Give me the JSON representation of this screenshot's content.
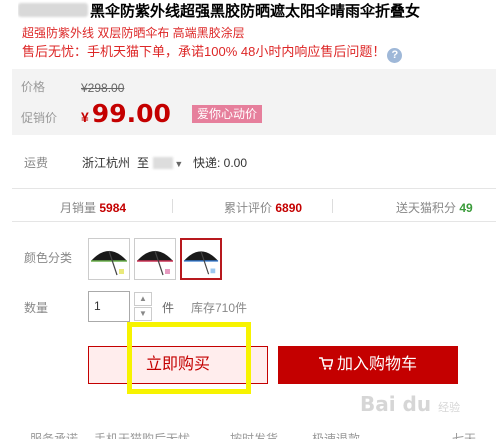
{
  "product": {
    "title": "黑伞防紫外线超强黑胶防晒遮太阳伞晴雨伞折叠女",
    "subtitle": "超强防紫外线 双层防晒伞布 高端黑胶涂层",
    "service_note": "售后无忧：手机天猫下单，承诺100% 48小时内响应售后问题！"
  },
  "price": {
    "orig_label": "价格",
    "orig_value": "¥298.00",
    "promo_label": "促销价",
    "currency": "¥",
    "promo_value": "99.00",
    "promo_tag": "爱你心动价"
  },
  "shipping": {
    "label": "运费",
    "from": "浙江杭州",
    "to_label": "至",
    "fee": "快递: 0.00"
  },
  "stats": {
    "monthly_label": "月销量",
    "monthly_value": "5984",
    "reviews_label": "累计评价",
    "reviews_value": "6890",
    "points_label": "送天猫积分",
    "points_value": "49"
  },
  "options": {
    "color_label": "颜色分类",
    "swatches": [
      {
        "name": "black-umbrella-1",
        "trim": "#6ab04c"
      },
      {
        "name": "black-umbrella-2",
        "trim": "#cc3355"
      },
      {
        "name": "black-umbrella-3",
        "trim": "#3377cc"
      }
    ]
  },
  "quantity": {
    "label": "数量",
    "value": "1",
    "unit": "件",
    "stock": "库存710件"
  },
  "actions": {
    "buy_now": "立即购买",
    "add_to_cart": "加入购物车"
  },
  "bottom": {
    "col1": "服务承诺",
    "col2": "手机天猫购后无忧",
    "col3": "按时发货",
    "col4": "极速退款",
    "col5": "七天"
  },
  "watermark": {
    "text": "Bai du",
    "sub": "经验"
  },
  "colors": {
    "accent": "#c40000",
    "promo_tag": "#e67f9c",
    "highlight": "#f7f300"
  }
}
